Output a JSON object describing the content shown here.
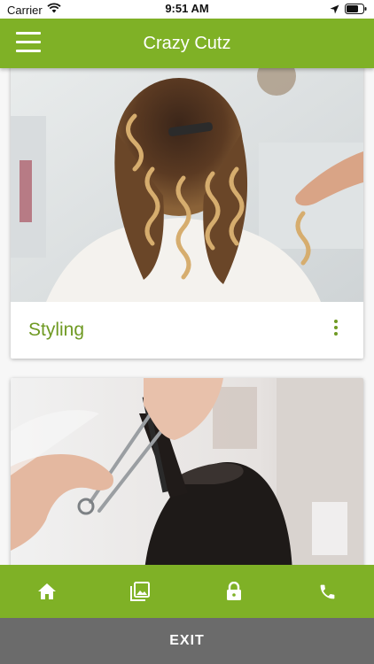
{
  "status_bar": {
    "carrier": "Carrier",
    "time": "9:51 AM"
  },
  "header": {
    "title": "Crazy Cutz",
    "menu_icon": "hamburger-menu-icon"
  },
  "cards": [
    {
      "label": "Styling",
      "image": "curled-hair-styling-photo",
      "menu_icon": "more-vert-icon"
    },
    {
      "label": "",
      "image": "hair-cutting-scissors-photo"
    }
  ],
  "bottom_nav": {
    "items": [
      {
        "icon": "home-icon"
      },
      {
        "icon": "gallery-icon"
      },
      {
        "icon": "lock-icon"
      },
      {
        "icon": "phone-icon"
      }
    ]
  },
  "exit": {
    "label": "EXIT"
  },
  "colors": {
    "brand_green": "#7fb126",
    "label_green": "#6f9a23",
    "exit_gray": "#6b6b6b"
  }
}
